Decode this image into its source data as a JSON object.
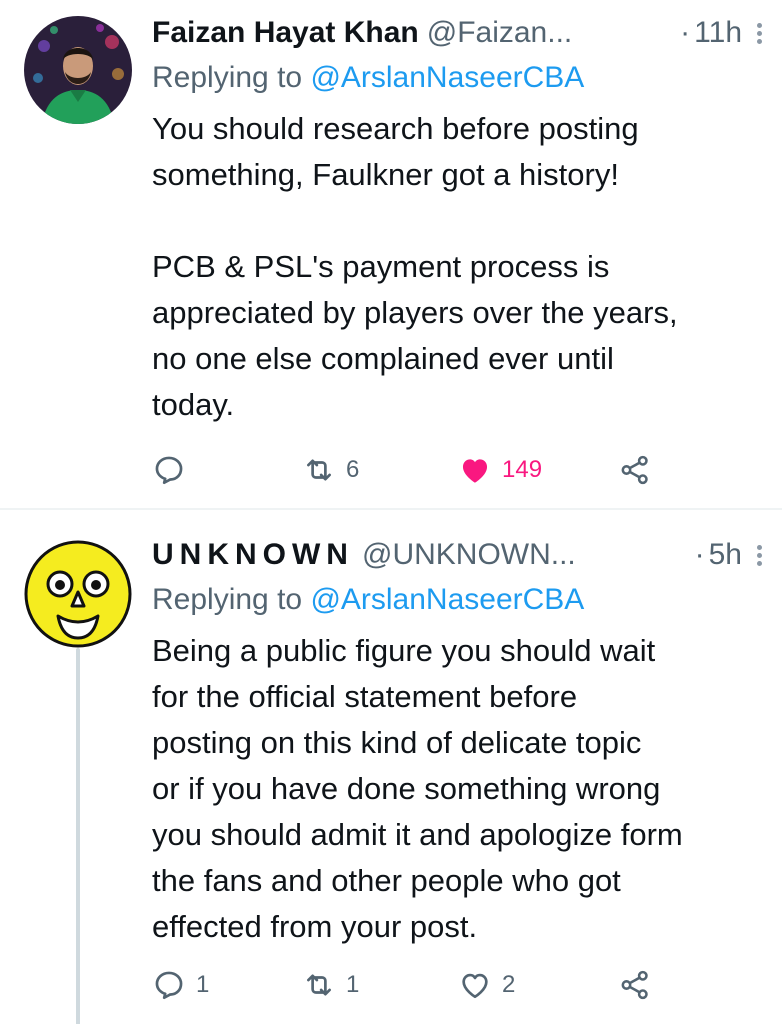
{
  "tweets": [
    {
      "name": "Faizan Hayat Khan",
      "handle": "@Faizan...",
      "separator": "·",
      "time": "11h",
      "replying_prefix": "Replying to ",
      "replying_to": "@ArslanNaseerCBA",
      "text": "You should research before posting\nsomething, Faulkner got a history!\n\nPCB & PSL's payment process is\nappreciated by players over the years,\nno one else complained ever until\ntoday.",
      "reply_count": "",
      "retweet_count": "6",
      "like_count": "149",
      "liked": true
    },
    {
      "name": "UNKNOWN",
      "handle": "@UNKNOWN...",
      "separator": "·",
      "time": "5h",
      "replying_prefix": "Replying to ",
      "replying_to": "@ArslanNaseerCBA",
      "text": "Being a public figure you should wait\nfor the official statement before\nposting on this kind of delicate topic\nor if you have done something wrong\nyou should admit it and apologize form\nthe fans and other people who got\neffected from your post.",
      "reply_count": "1",
      "retweet_count": "1",
      "like_count": "2",
      "liked": false
    }
  ],
  "colors": {
    "text": "#0f1419",
    "secondary": "#536471",
    "link": "#1d9bf0",
    "like": "#f91880",
    "divider": "#eff3f4",
    "thread_line": "#cfd9de"
  }
}
